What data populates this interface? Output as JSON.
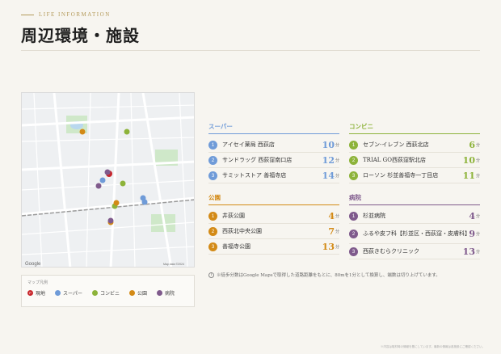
{
  "header": {
    "eyebrow": "LIFE INFORMATION",
    "title": "周辺環境・施設"
  },
  "legend": {
    "title": "マップ凡例",
    "items": [
      {
        "label": "現地",
        "color": "#c8262c",
        "icon": "P"
      },
      {
        "label": "スーパー",
        "color": "#6f9bd8"
      },
      {
        "label": "コンビニ",
        "color": "#8db33a"
      },
      {
        "label": "公園",
        "color": "#d38a16"
      },
      {
        "label": "病院",
        "color": "#7f5a8c"
      }
    ]
  },
  "categories": {
    "supermarket": {
      "title": "スーパー",
      "color": "#6f9bd8",
      "minute_color": "#6f9bd8",
      "items": [
        {
          "no": "1",
          "name": "アイセイ薬局 西荻店",
          "minutes": "10",
          "unit": "分"
        },
        {
          "no": "2",
          "name": "サンドラッグ 西荻窪南口店",
          "minutes": "12",
          "unit": "分"
        },
        {
          "no": "3",
          "name": "サミットストア 善福寺店",
          "minutes": "14",
          "unit": "分"
        }
      ]
    },
    "convenience": {
      "title": "コンビニ",
      "color": "#8db33a",
      "minute_color": "#8db33a",
      "items": [
        {
          "no": "1",
          "name": "セブン-イレブン 西荻北店",
          "minutes": "6",
          "unit": "分"
        },
        {
          "no": "2",
          "name": "TRIAL GO西荻窪駅北店",
          "minutes": "10",
          "unit": "分"
        },
        {
          "no": "3",
          "name": "ローソン 杉並善福寺一丁目店",
          "minutes": "11",
          "unit": "分"
        }
      ]
    },
    "park": {
      "title": "公園",
      "color": "#d38a16",
      "minute_color": "#d38a16",
      "items": [
        {
          "no": "1",
          "name": "井荻公園",
          "minutes": "4",
          "unit": "分"
        },
        {
          "no": "2",
          "name": "西荻北中央公園",
          "minutes": "7",
          "unit": "分"
        },
        {
          "no": "3",
          "name": "善福寺公園",
          "minutes": "13",
          "unit": "分"
        }
      ]
    },
    "hospital": {
      "title": "病院",
      "color": "#7f5a8c",
      "minute_color": "#7f5a8c",
      "items": [
        {
          "no": "1",
          "name": "杉並病院",
          "minutes": "4",
          "unit": "分"
        },
        {
          "no": "2",
          "name": "ふるや皮フ科【杉並区・西荻窪・皮膚科】",
          "minutes": "9",
          "unit": "分"
        },
        {
          "no": "3",
          "name": "西荻きむらクリニック",
          "minutes": "13",
          "unit": "分"
        }
      ]
    }
  },
  "note": "※徒歩分数はGoogle Mapsで取得した道路距離をもとに、80mを1分として換算し、端数は切り上げています。",
  "footer": "※内容は取材時の情報を基にしています。最新の情報は各施設にご確認ください。",
  "map": {
    "google_label": "Google",
    "data_label": "Map data ©2024"
  }
}
